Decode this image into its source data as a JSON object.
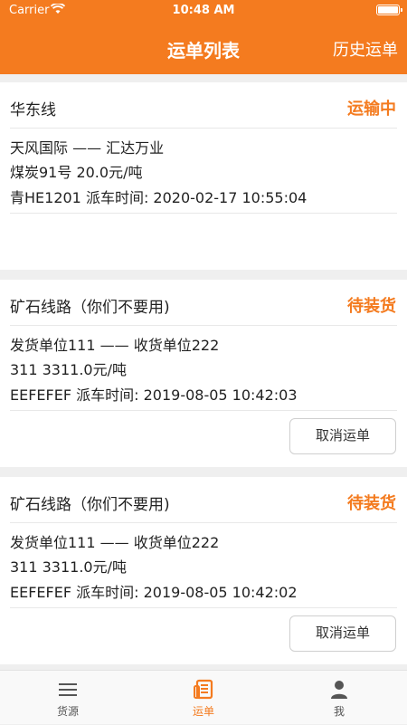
{
  "status_bar": {
    "carrier": "Carrier",
    "time": "10:48 AM"
  },
  "header": {
    "title": "运单列表",
    "right_action": "历史运单"
  },
  "orders": [
    {
      "route": "华东线",
      "status": "运输中",
      "parties": "天风国际 —— 汇达万业",
      "cargo": "煤炭91号  20.0元/吨",
      "vehicle_time": "青HE1201  派车时间: 2020-02-17 10:55:04",
      "cancel_label": ""
    },
    {
      "route": "矿石线路（你们不要用)",
      "status": "待装货",
      "parties": "发货单位111 —— 收货单位222",
      "cargo": "311  3311.0元/吨",
      "vehicle_time": "EEFEFEF  派车时间: 2019-08-05 10:42:03",
      "cancel_label": "取消运单"
    },
    {
      "route": "矿石线路（你们不要用)",
      "status": "待装货",
      "parties": "发货单位111 —— 收货单位222",
      "cargo": "311  3311.0元/吨",
      "vehicle_time": "EEFEFEF  派车时间: 2019-08-05 10:42:02",
      "cancel_label": "取消运单"
    }
  ],
  "tabs": [
    {
      "label": "货源",
      "icon": "list-icon",
      "active": false
    },
    {
      "label": "运单",
      "icon": "waybill-icon",
      "active": true
    },
    {
      "label": "我",
      "icon": "person-icon",
      "active": false
    }
  ],
  "colors": {
    "brand": "#f47b1f",
    "background": "#efefef"
  }
}
